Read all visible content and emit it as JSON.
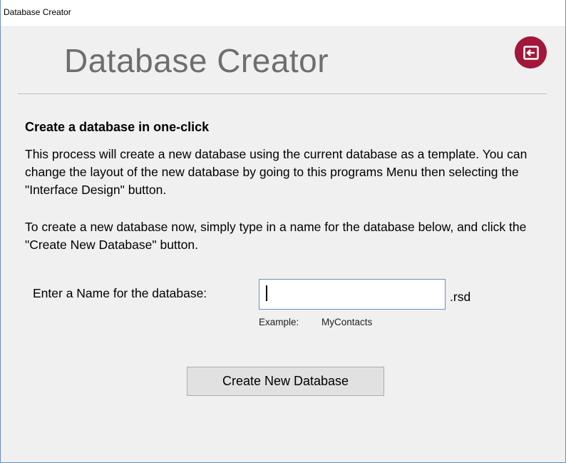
{
  "window": {
    "title": "Database Creator"
  },
  "header": {
    "title": "Database Creator",
    "exit_icon": "exit-icon",
    "accent_color": "#a3173a"
  },
  "content": {
    "subheading": "Create a database in one-click",
    "paragraph1": "This process will create a new database using the current database as a template.  You can change the layout of the new database by going to this programs Menu then selecting the \"Interface Design\" button.",
    "paragraph2": "To create a new database now, simply type in a name for the database below, and click the \"Create New Database\" button."
  },
  "form": {
    "name_label": "Enter a Name for the database:",
    "name_value": "",
    "extension": ".rsd",
    "example_label": "Example:",
    "example_value": "MyContacts",
    "create_button_label": "Create New Database"
  }
}
